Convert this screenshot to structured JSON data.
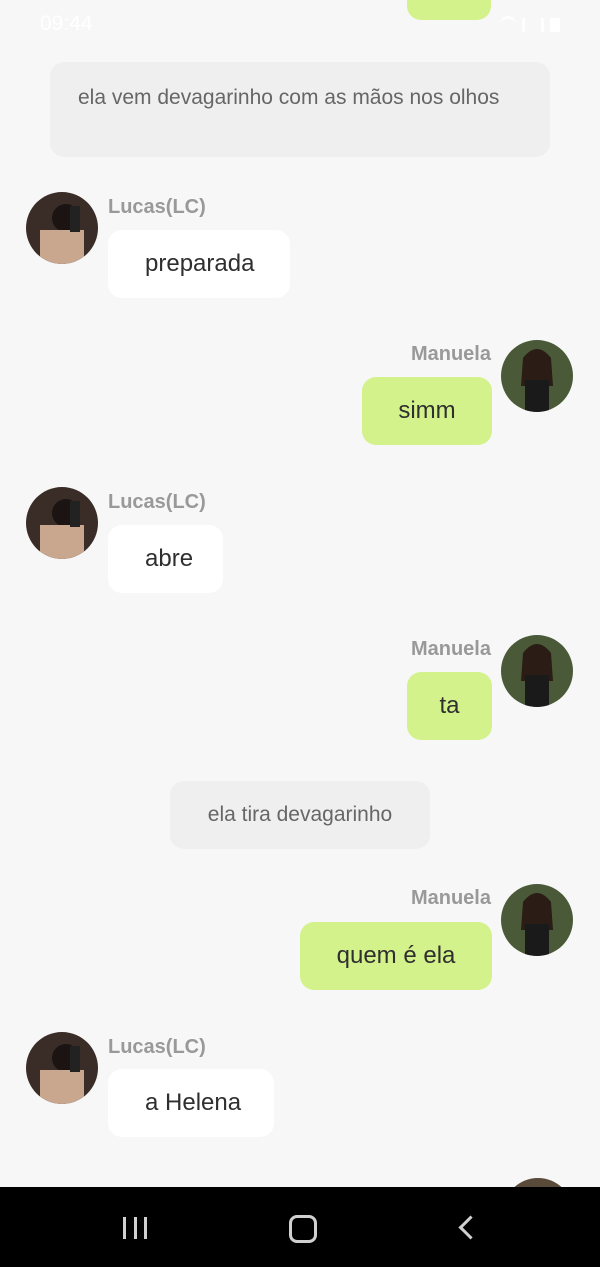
{
  "status_bar": {
    "time": "09:44"
  },
  "messages": [
    {
      "type": "narration",
      "text": "ela vem devagarinho com as mãos nos olhos"
    },
    {
      "type": "incoming",
      "sender": "Lucas(LC)",
      "text": "preparada"
    },
    {
      "type": "outgoing",
      "sender": "Manuela",
      "text": "simm"
    },
    {
      "type": "incoming",
      "sender": "Lucas(LC)",
      "text": "abre"
    },
    {
      "type": "outgoing",
      "sender": "Manuela",
      "text": "ta"
    },
    {
      "type": "narration",
      "text": "ela tira devagarinho"
    },
    {
      "type": "outgoing",
      "sender": "Manuela",
      "text": "quem é ela"
    },
    {
      "type": "incoming",
      "sender": "Lucas(LC)",
      "text": "a Helena"
    }
  ],
  "colors": {
    "background": "#f7f7f7",
    "outgoing_bubble": "#d4f28b",
    "incoming_bubble": "#ffffff",
    "narration_bubble": "#efefef"
  },
  "icons": {
    "nav_recent": "recent-apps-icon",
    "nav_home": "home-icon",
    "nav_back": "back-icon"
  }
}
